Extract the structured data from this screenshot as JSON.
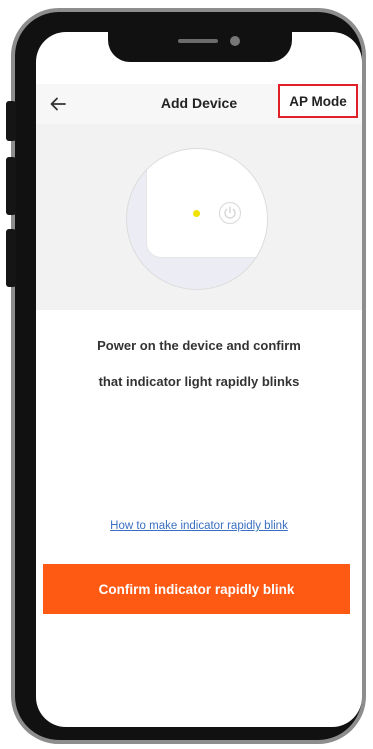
{
  "header": {
    "title": "Add Device",
    "right_action": "AP Mode"
  },
  "icons": {
    "back": "back-arrow-icon",
    "power": "power-icon"
  },
  "instruction": {
    "line1": "Power on the device and confirm",
    "line2": "that indicator light rapidly blinks"
  },
  "help_link": "How to make indicator rapidly blink",
  "confirm_button": "Confirm indicator rapidly blink",
  "colors": {
    "accent": "#ff5a14",
    "highlight_border": "#e01f26",
    "indicator_light": "#f2e200",
    "link": "#3a6fc2"
  }
}
